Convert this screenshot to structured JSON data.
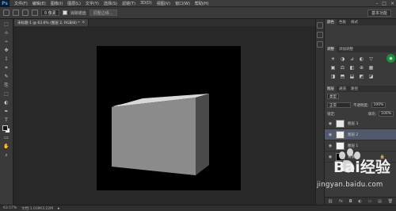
{
  "app": {
    "logo": "Ps"
  },
  "menu": [
    "文件(F)",
    "编辑(E)",
    "图像(I)",
    "图层(L)",
    "文字(Y)",
    "选择(S)",
    "滤镜(T)",
    "3D(D)",
    "视图(V)",
    "窗口(W)",
    "帮助(H)"
  ],
  "window_controls": [
    "–",
    "□",
    "×"
  ],
  "options": {
    "feather_value": "0 像素",
    "anti_alias_label": "消除锯齿",
    "style_label": "调整边缘...",
    "workspace": "基本功能"
  },
  "tabs": [
    {
      "label": "未标题-1 @ 63.6% (图层 2, RGB/8) *",
      "active": true
    },
    {
      "label": "×",
      "active": false
    }
  ],
  "tools": [
    "⬚",
    "⊹",
    "⌁",
    "✥",
    "⟟",
    "⌗",
    "✎",
    "⎘",
    "⬚",
    "◐",
    "✒",
    "T",
    "↖",
    "▭",
    "✋",
    "⌕"
  ],
  "panels": {
    "top_tabs": [
      "颜色",
      "色板",
      "样式"
    ],
    "adjust_tabs": [
      "调整",
      "添加调整"
    ],
    "adjust_icons": [
      "☀",
      "◑",
      "⊿",
      "◐",
      "▽",
      "▣",
      "⚖",
      "◧",
      "⊕",
      "▦",
      "◨",
      "⬒",
      "⬓",
      "◩",
      "◪"
    ],
    "layers_tabs": [
      "图层",
      "通道",
      "路径"
    ],
    "kind_label": "类型",
    "blend_mode": "正常",
    "opacity_label": "不透明度:",
    "opacity_value": "100%",
    "lock_label": "锁定:",
    "fill_label": "填充:",
    "fill_value": "100%",
    "layers": [
      {
        "name": "图层 3",
        "selected": false,
        "thumb": "#e8e8e8"
      },
      {
        "name": "图层 2",
        "selected": true,
        "thumb": "#f0f0f0"
      },
      {
        "name": "图层 1",
        "selected": false,
        "thumb": "#f4f4f4"
      },
      {
        "name": "背景",
        "selected": false,
        "thumb": "#000000",
        "locked": true
      }
    ],
    "bottom_icons": [
      "⛓",
      "fx",
      "◘",
      "◐",
      "▭",
      "▤",
      "🗑"
    ]
  },
  "status": {
    "zoom": "63.57%",
    "doc": "文档:1.03M/3.22M"
  },
  "watermark": {
    "brand": "Bai经验",
    "url": "jingyan.baidu.com"
  },
  "colors": {
    "accent": "#31a8ff",
    "selected_layer": "#505a6c",
    "cube_front": "#8b8b8b",
    "cube_top": "#d9d9d9",
    "cube_side": "#4a4a4a"
  }
}
